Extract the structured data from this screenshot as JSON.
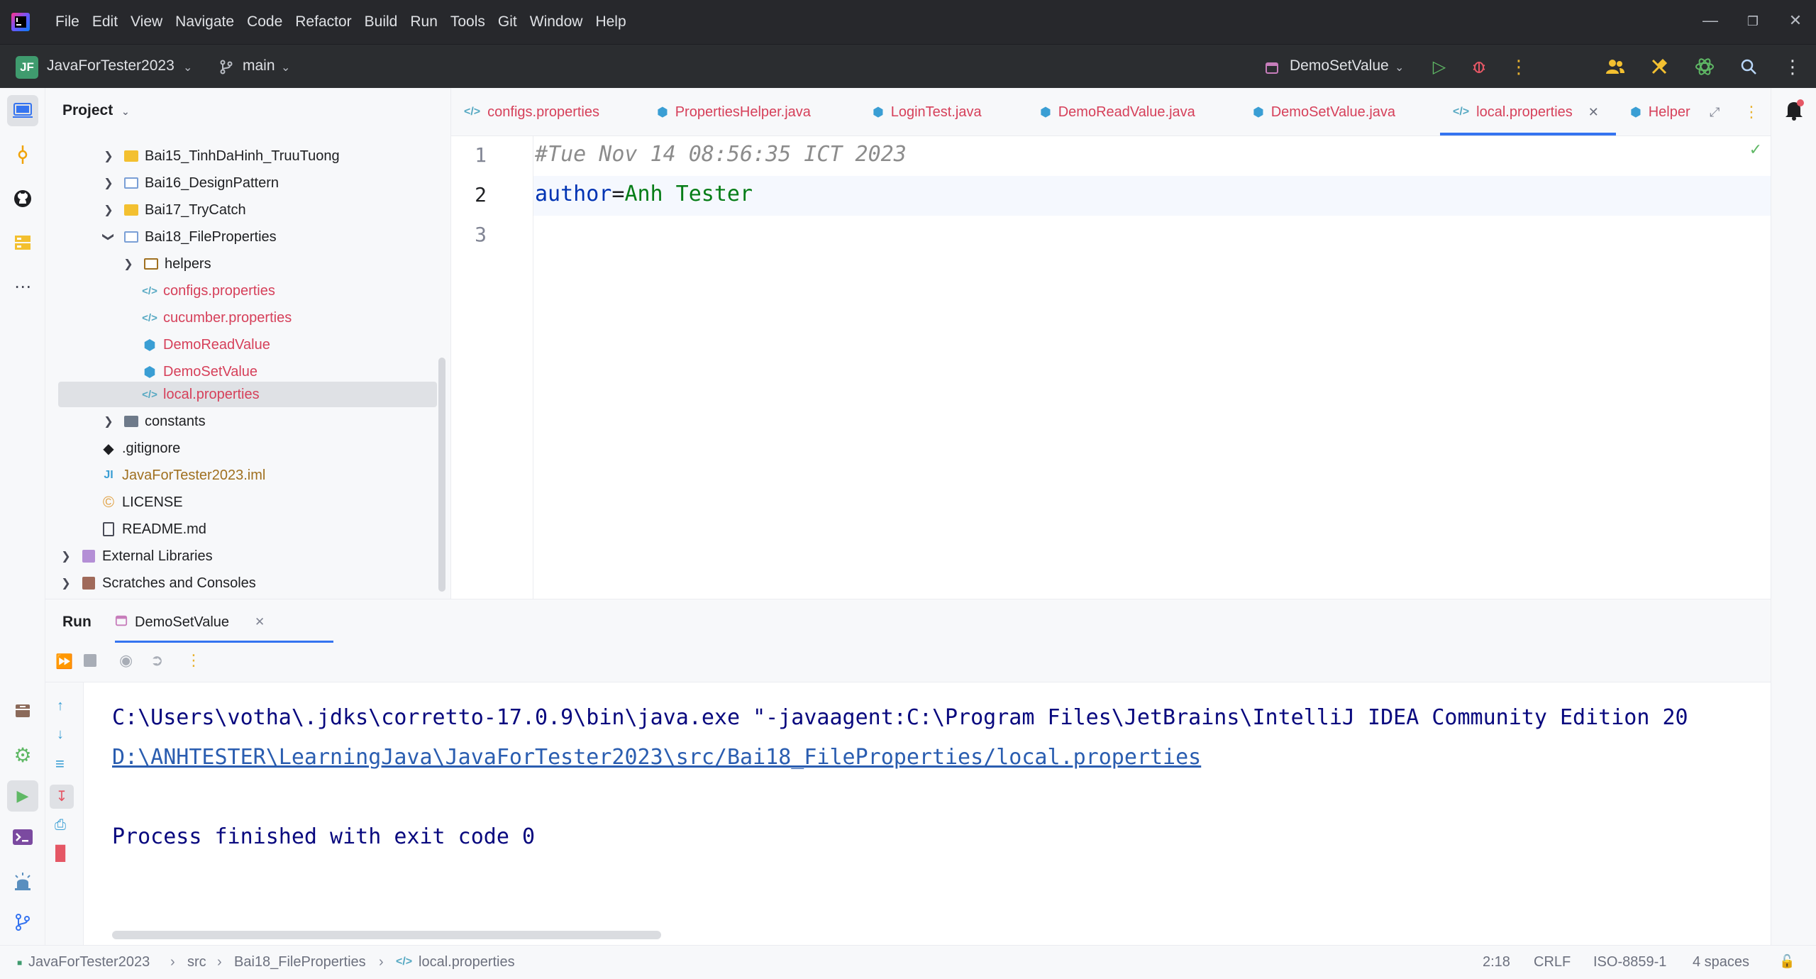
{
  "menu": [
    "File",
    "Edit",
    "View",
    "Navigate",
    "Code",
    "Refactor",
    "Build",
    "Run",
    "Tools",
    "Git",
    "Window",
    "Help"
  ],
  "toolbar": {
    "project_badge": "JF",
    "project_name": "JavaForTester2023",
    "branch": "main",
    "run_config": "DemoSetValue"
  },
  "project_panel": {
    "title": "Project",
    "items": [
      {
        "label": "Bai15_TinhDaHinh_TruuTuong",
        "type": "folder",
        "expanded": false
      },
      {
        "label": "Bai16_DesignPattern",
        "type": "package",
        "expanded": false
      },
      {
        "label": "Bai17_TryCatch",
        "type": "folder",
        "expanded": false
      },
      {
        "label": "Bai18_FileProperties",
        "type": "package",
        "expanded": true
      },
      {
        "label": "helpers",
        "type": "folder",
        "expanded": false
      },
      {
        "label": "configs.properties",
        "type": "properties"
      },
      {
        "label": "cucumber.properties",
        "type": "properties"
      },
      {
        "label": "DemoReadValue",
        "type": "class"
      },
      {
        "label": "DemoSetValue",
        "type": "class"
      },
      {
        "label": "local.properties",
        "type": "properties",
        "selected": true
      },
      {
        "label": "constants",
        "type": "folder",
        "expanded": false
      },
      {
        "label": ".gitignore",
        "type": "git"
      },
      {
        "label": "JavaForTester2023.iml",
        "type": "iml"
      },
      {
        "label": "LICENSE",
        "type": "license"
      },
      {
        "label": "README.md",
        "type": "md"
      },
      {
        "label": "External Libraries",
        "type": "libs",
        "expanded": false
      },
      {
        "label": "Scratches and Consoles",
        "type": "scratch",
        "expanded": false
      }
    ]
  },
  "tabs": [
    {
      "label": "configs.properties",
      "type": "properties"
    },
    {
      "label": "PropertiesHelper.java",
      "type": "class"
    },
    {
      "label": "LoginTest.java",
      "type": "class"
    },
    {
      "label": "DemoReadValue.java",
      "type": "class"
    },
    {
      "label": "DemoSetValue.java",
      "type": "class"
    },
    {
      "label": "local.properties",
      "type": "properties",
      "active": true
    },
    {
      "label": "Helper",
      "type": "class"
    }
  ],
  "editor": {
    "line_numbers": [
      "1",
      "2",
      "3"
    ],
    "comment": "#Tue Nov 14 08:56:35 ICT 2023",
    "key": "author",
    "eq": "=",
    "value": "Anh Tester"
  },
  "run_window": {
    "title": "Run",
    "tab_label": "DemoSetValue",
    "console": {
      "command": "C:\\Users\\votha\\.jdks\\corretto-17.0.9\\bin\\java.exe \"-javaagent:C:\\Program Files\\JetBrains\\IntelliJ IDEA Community Edition 20",
      "path_link": "D:\\ANHTESTER\\LearningJava\\JavaForTester2023\\src/Bai18_FileProperties/local.properties",
      "exit": "Process finished with exit code 0"
    }
  },
  "statusbar": {
    "breadcrumb": [
      "JavaForTester2023",
      "src",
      "Bai18_FileProperties",
      "local.properties"
    ],
    "position": "2:18",
    "line_sep": "CRLF",
    "encoding": "ISO-8859-1",
    "indent": "4 spaces"
  },
  "colors": {
    "accent": "#3574f0",
    "error_file": "#d6405a",
    "comment": "#8c8c8c",
    "key": "#0033b3",
    "value": "#067d17",
    "console_text": "#08087e"
  }
}
